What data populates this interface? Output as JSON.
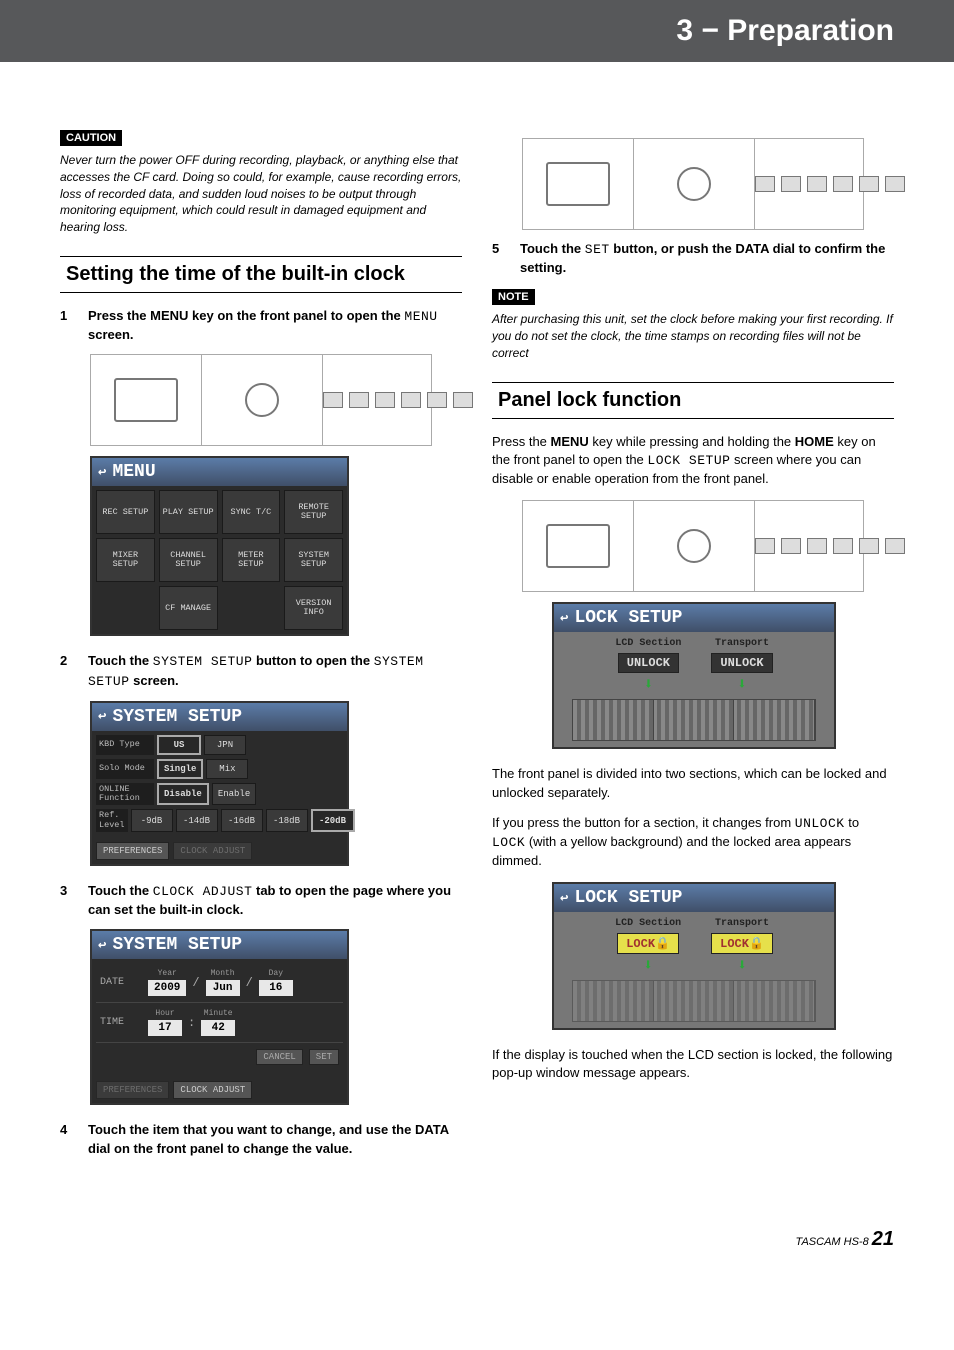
{
  "header": {
    "title": "3 − Preparation"
  },
  "caution": {
    "label": "CAUTION",
    "text": "Never turn the power OFF during recording, playback, or anything else that accesses the CF card. Doing so could, for example, cause recording errors, loss of recorded data, and sudden loud noises to be output through monitoring equipment, which could result in damaged equipment and hearing loss."
  },
  "section1": {
    "title": "Setting the time of the built-in clock",
    "steps": {
      "s1a": "Press the ",
      "s1b": "MENU",
      "s1c": " key on the front panel to open the ",
      "s1d": "MENU",
      "s1e": " screen.",
      "s2a": "Touch the ",
      "s2b": "SYSTEM SETUP",
      "s2c": " button to open the ",
      "s2d": "SYSTEM SETUP",
      "s2e": " screen.",
      "s3a": "Touch the ",
      "s3b": "CLOCK ADJUST",
      "s3c": " tab to open the page where you can set the built-in clock.",
      "s4": "Touch the item that you want to change, and use the ",
      "s4b": "DATA",
      "s4c": " dial on the front panel to change the value.",
      "s5a": "Touch the ",
      "s5b": "SET",
      "s5c": " button, or push the ",
      "s5d": "DATA",
      "s5e": " dial to confirm the setting."
    }
  },
  "device_label": "HS-8",
  "menu_screen": {
    "title": "MENU",
    "items": [
      "REC SETUP",
      "PLAY SETUP",
      "SYNC T/C",
      "REMOTE SETUP",
      "MIXER SETUP",
      "CHANNEL SETUP",
      "METER SETUP",
      "SYSTEM SETUP",
      "",
      "CF MANAGE",
      "",
      "VERSION INFO"
    ]
  },
  "system_setup_screen": {
    "title": "SYSTEM SETUP",
    "rows": [
      {
        "label": "KBD Type",
        "selected": "US",
        "options": [
          "US",
          "JPN"
        ]
      },
      {
        "label": "Solo Mode",
        "selected": "Single",
        "options": [
          "Single",
          "Mix"
        ]
      },
      {
        "label": "ONLINE Function",
        "selected": "Disable",
        "options": [
          "Disable",
          "Enable"
        ]
      },
      {
        "label": "Ref. Level",
        "selected": "-20dB",
        "options": [
          "-9dB",
          "-14dB",
          "-16dB",
          "-18dB",
          "-20dB"
        ]
      }
    ],
    "tabs": [
      "PREFERENCES",
      "CLOCK ADJUST"
    ]
  },
  "clock_screen": {
    "title": "SYSTEM SETUP",
    "date_label": "DATE",
    "time_label": "TIME",
    "date": {
      "year_label": "Year",
      "month_label": "Month",
      "day_label": "Day",
      "year": "2009",
      "month": "Jun",
      "day": "16"
    },
    "time": {
      "hour_label": "Hour",
      "minute_label": "Minute",
      "hour": "17",
      "minute": "42"
    },
    "buttons": {
      "cancel": "CANCEL",
      "set": "SET"
    },
    "tabs": [
      "PREFERENCES",
      "CLOCK ADJUST"
    ]
  },
  "note": {
    "label": "NOTE",
    "text": "After purchasing this unit, set the clock before making your first recording. If you do not set the clock, the time stamps on recording files will not be correct"
  },
  "section2": {
    "title": "Panel lock function",
    "p1a": "Press the ",
    "p1b": "MENU",
    "p1c": " key while pressing and holding the ",
    "p1d": "HOME",
    "p1e": " key on the front panel to open the ",
    "p1f": "LOCK SETUP",
    "p1g": " screen where you can disable or enable operation from the front panel.",
    "p2": "The front panel is divided into two sections, which can be locked and unlocked separately.",
    "p3a": "If you press the button for a section, it changes from ",
    "p3b": "UNLOCK",
    "p3c": " to ",
    "p3d": "LOCK",
    "p3e": " (with a yellow background) and the locked area appears dimmed.",
    "p4": "If the display is touched when the LCD section is locked, the following pop-up window message appears."
  },
  "lock_screen_unlock": {
    "title": "LOCK SETUP",
    "col1_label": "LCD Section",
    "col2_label": "Transport",
    "state": "UNLOCK"
  },
  "lock_screen_lock": {
    "title": "LOCK SETUP",
    "col1_label": "LCD Section",
    "col2_label": "Transport",
    "state_text": "LOCK",
    "lock_icon": "🔒"
  },
  "footer": {
    "brand": "TASCAM  HS-8",
    "page": "21"
  }
}
